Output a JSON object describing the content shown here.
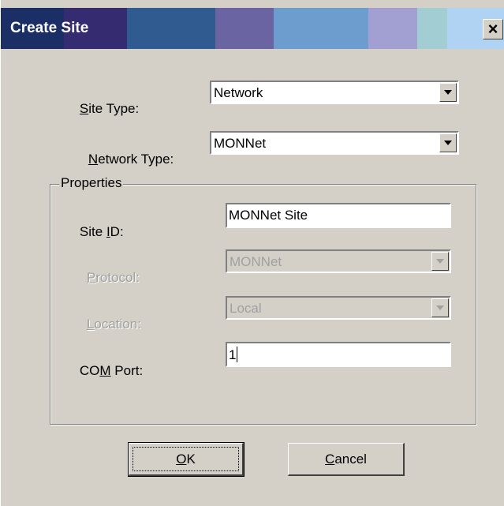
{
  "dialog": {
    "title": "Create Site",
    "close_label": "×",
    "titlebar_colors": [
      "#1b2f66",
      "#352b71",
      "#2f5b91",
      "#6a65a2",
      "#6c9dce",
      "#a29fd2",
      "#a2ced3",
      "#b0d3f4"
    ]
  },
  "site_type": {
    "label_accel": "S",
    "label_rest": "ite Type:",
    "value": "Network"
  },
  "network_type": {
    "label_accel": "N",
    "label_rest": "etwork Type:",
    "value": "MONNet"
  },
  "properties": {
    "title": "Properties",
    "site_id": {
      "label_pre": "Site ",
      "label_accel": "I",
      "label_post": "D:",
      "value": "MONNet Site"
    },
    "protocol": {
      "label_accel": "P",
      "label_rest": "rotocol:",
      "value": "MONNet"
    },
    "location": {
      "label_accel": "L",
      "label_rest": "ocation:",
      "value": "Local"
    },
    "com_port": {
      "label_pre": "CO",
      "label_accel": "M",
      "label_post": " Port:",
      "value": "1"
    }
  },
  "buttons": {
    "ok_accel": "O",
    "ok_rest": "K",
    "cancel_accel": "C",
    "cancel_rest": "ancel"
  }
}
